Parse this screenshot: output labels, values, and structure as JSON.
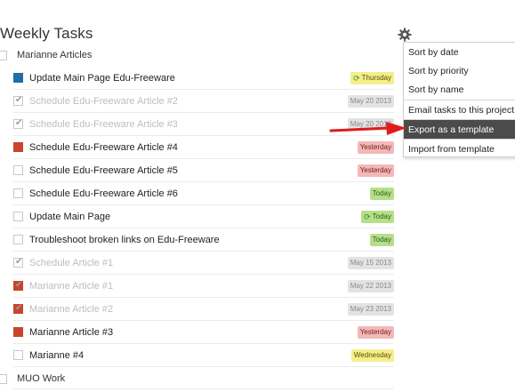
{
  "page": {
    "title": "Weekly Tasks"
  },
  "projects": [
    {
      "label": "Marianne Articles"
    },
    {
      "label": "MUO Work"
    }
  ],
  "tasks": [
    {
      "label": "Update Main Page Edu-Freeware",
      "due": "Thursday",
      "done": false,
      "priority": "blue",
      "repeat": true
    },
    {
      "label": "Schedule Edu-Freeware Article #2",
      "due": "May 20 2013",
      "done": true,
      "priority": "none",
      "repeat": false
    },
    {
      "label": "Schedule Edu-Freeware Article #3",
      "due": "May 20 2013",
      "done": true,
      "priority": "none",
      "repeat": false
    },
    {
      "label": "Schedule Edu-Freeware Article #4",
      "due": "Yesterday",
      "done": false,
      "priority": "red",
      "repeat": false
    },
    {
      "label": "Schedule Edu-Freeware Article #5",
      "due": "Yesterday",
      "done": false,
      "priority": "none",
      "repeat": false
    },
    {
      "label": "Schedule Edu-Freeware Article #6",
      "due": "Today",
      "done": false,
      "priority": "none",
      "repeat": false
    },
    {
      "label": "Update Main Page",
      "due": "Today",
      "done": false,
      "priority": "none",
      "repeat": true
    },
    {
      "label": "Troubleshoot broken links on Edu-Freeware",
      "due": "Today",
      "done": false,
      "priority": "none",
      "repeat": false
    },
    {
      "label": "Schedule Article #1",
      "due": "May 15 2013",
      "done": true,
      "priority": "none",
      "repeat": false
    },
    {
      "label": "Marianne Article #1",
      "due": "May 22 2013",
      "done": true,
      "priority": "red",
      "repeat": false
    },
    {
      "label": "Marianne Article #2",
      "due": "May 23 2013",
      "done": true,
      "priority": "red",
      "repeat": false
    },
    {
      "label": "Marianne Article #3",
      "due": "Yesterday",
      "done": false,
      "priority": "red",
      "repeat": false
    },
    {
      "label": "Marianne #4",
      "due": "Wednesday",
      "done": false,
      "priority": "none",
      "repeat": false
    }
  ],
  "menu": {
    "items": [
      {
        "label": "Sort by date"
      },
      {
        "label": "Sort by priority"
      },
      {
        "label": "Sort by name"
      },
      {
        "label": "Email tasks to this project"
      },
      {
        "label": "Export as a template"
      },
      {
        "label": "Import from template"
      }
    ],
    "active_index": 4
  },
  "colors": {
    "priority_blue": "#1f6ea8",
    "priority_red": "#c8452c",
    "badge_overdue_bg": "#f4b8b8",
    "badge_today_bg": "#b5e08a",
    "badge_future_bg": "#f5ee8c",
    "badge_done_bg": "#e3e3e3",
    "menu_active_bg": "#4b4b4b",
    "arrow": "#e01b1b"
  },
  "icons": {
    "settings": "gear-icon",
    "pointer": "red-arrow-icon",
    "repeat": "repeat-icon"
  }
}
